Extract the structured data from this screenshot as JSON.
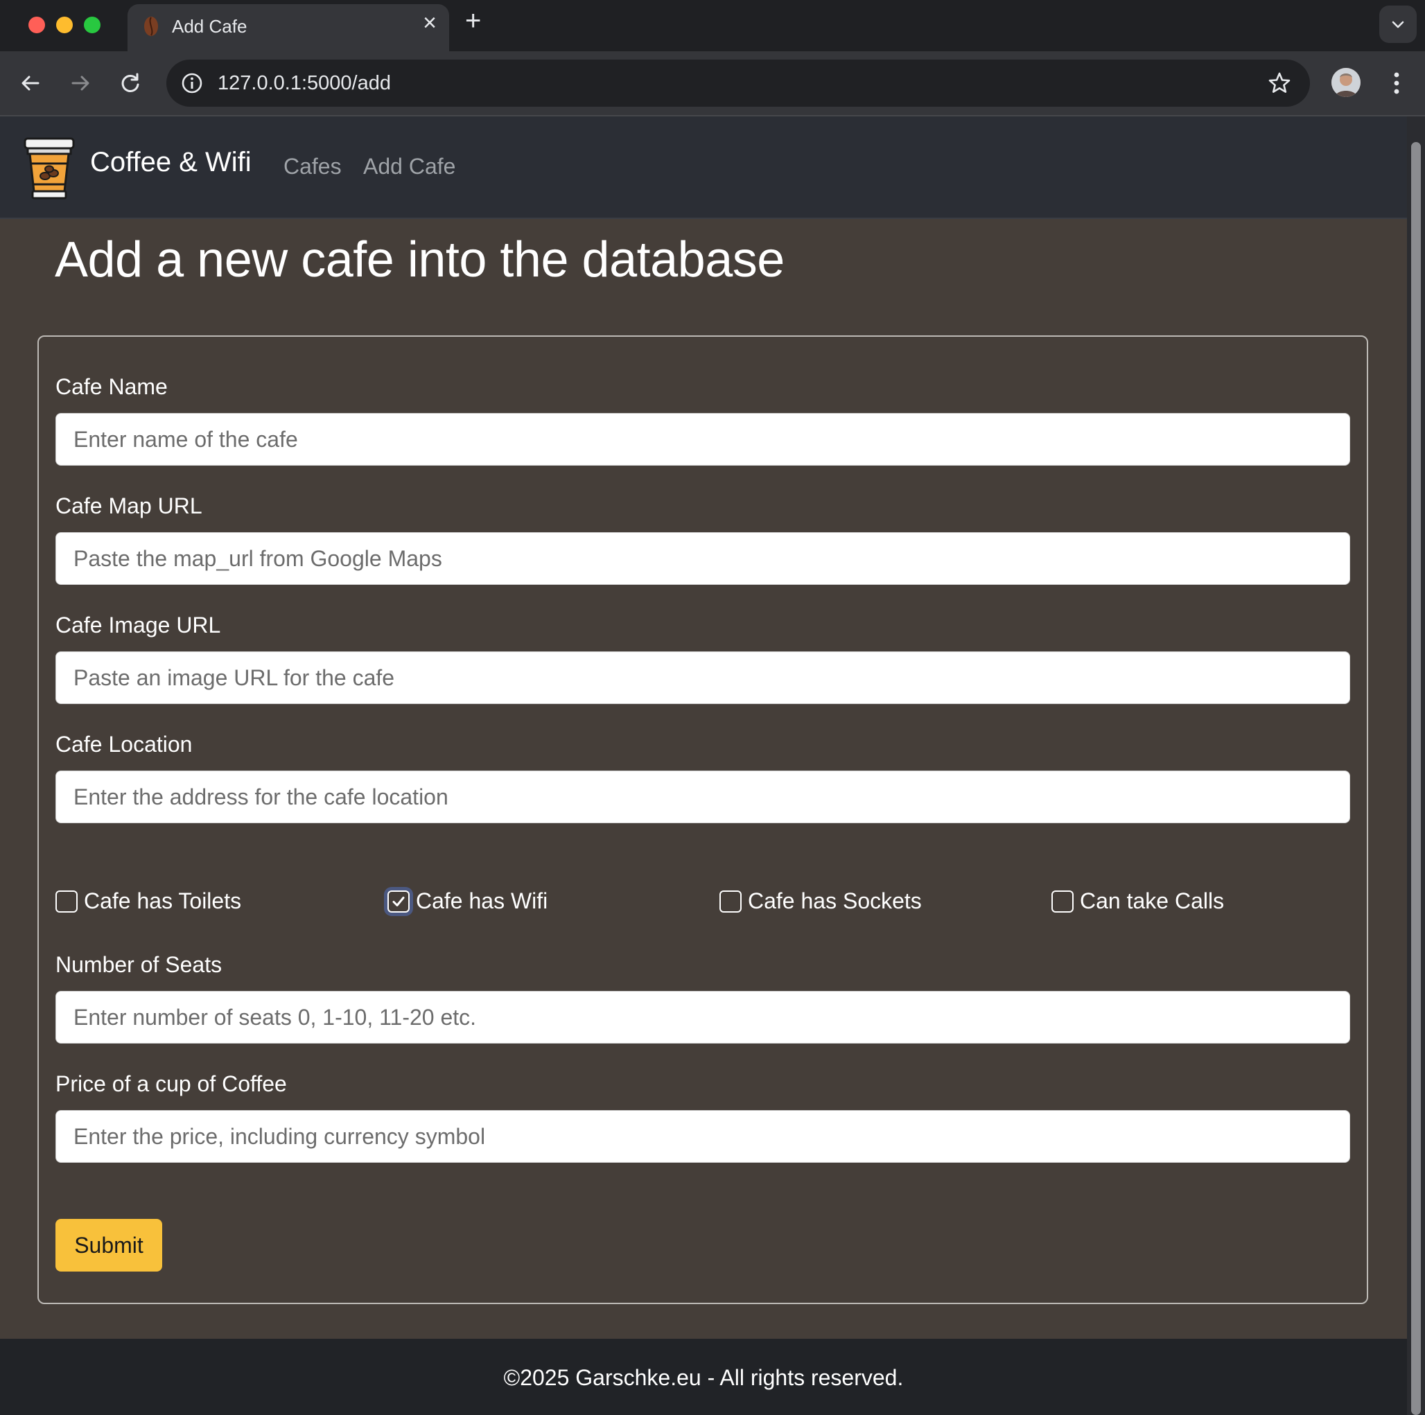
{
  "browser": {
    "tab_title": "Add Cafe",
    "url": "127.0.0.1:5000/add",
    "icons": {
      "back": "back-arrow-icon",
      "forward": "forward-arrow-icon",
      "reload": "reload-icon",
      "info": "site-info-icon",
      "bookmark": "star-icon",
      "menu": "three-dots-icon",
      "new_tab": "plus-icon",
      "close_tab": "close-icon",
      "tab_search": "chevron-down-icon"
    }
  },
  "navbar": {
    "brand": "Coffee & Wifi",
    "links": [
      "Cafes",
      "Add Cafe"
    ]
  },
  "page": {
    "title": "Add a new cafe into the database"
  },
  "form": {
    "fields": {
      "name": {
        "label": "Cafe Name",
        "placeholder": "Enter name of the cafe",
        "value": ""
      },
      "map_url": {
        "label": "Cafe Map URL",
        "placeholder": "Paste the map_url from Google Maps",
        "value": ""
      },
      "img_url": {
        "label": "Cafe Image URL",
        "placeholder": "Paste an image URL for the cafe",
        "value": ""
      },
      "location": {
        "label": "Cafe Location",
        "placeholder": "Enter the address for the cafe location",
        "value": ""
      },
      "seats": {
        "label": "Number of Seats",
        "placeholder": "Enter number of seats 0, 1-10, 11-20 etc.",
        "value": ""
      },
      "coffee_price": {
        "label": "Price of a cup of Coffee",
        "placeholder": "Enter the price, including currency symbol",
        "value": ""
      }
    },
    "checkboxes": [
      {
        "label": "Cafe has Toilets",
        "checked": false
      },
      {
        "label": "Cafe has Wifi",
        "checked": true
      },
      {
        "label": "Cafe has Sockets",
        "checked": false
      },
      {
        "label": "Can take Calls",
        "checked": false
      }
    ],
    "submit_label": "Submit"
  },
  "footer": {
    "text": "©2025 Garschke.eu - All rights reserved."
  },
  "colors": {
    "page_bg": "#453e39",
    "navbar_bg": "#2b2e35",
    "footer_bg": "#212327",
    "submit_bg": "#f8c13b",
    "logo_orange": "#f2a33a"
  }
}
